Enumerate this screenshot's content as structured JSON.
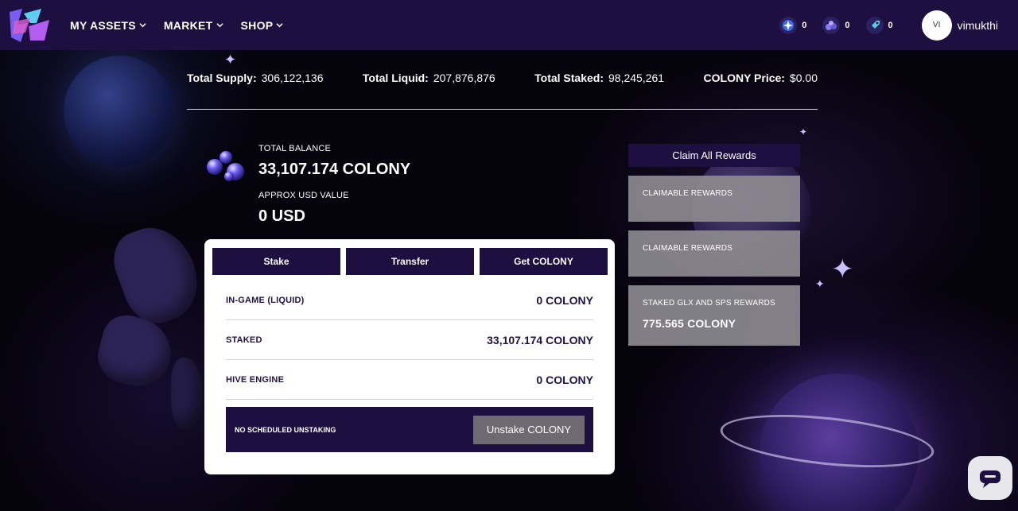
{
  "nav": {
    "items": [
      {
        "label": "MY ASSETS"
      },
      {
        "label": "MARKET"
      },
      {
        "label": "SHOP"
      }
    ]
  },
  "currencies": [
    {
      "icon": "star-orb-icon",
      "value": "0"
    },
    {
      "icon": "gem-cluster-icon",
      "value": "0"
    },
    {
      "icon": "rocket-icon",
      "value": "0"
    }
  ],
  "user": {
    "initials": "VI",
    "name": "vimukthi"
  },
  "stats": {
    "supply_label": "Total Supply:",
    "supply_value": "306,122,136",
    "liquid_label": "Total Liquid:",
    "liquid_value": "207,876,876",
    "staked_label": "Total Staked:",
    "staked_value": "98,245,261",
    "price_label": "COLONY Price:",
    "price_value": "$0.00"
  },
  "balance": {
    "total_label": "TOTAL BALANCE",
    "total_value": "33,107.174 COLONY",
    "usd_label": "APPROX USD VALUE",
    "usd_value": "0 USD"
  },
  "tabs": [
    "Stake",
    "Transfer",
    "Get COLONY"
  ],
  "rows": [
    {
      "label": "IN-GAME (LIQUID)",
      "value": "0 COLONY"
    },
    {
      "label": "STAKED",
      "value": "33,107.174 COLONY"
    },
    {
      "label": "HIVE ENGINE",
      "value": "0 COLONY"
    }
  ],
  "unstake": {
    "status": "NO SCHEDULED UNSTAKING",
    "button": "Unstake COLONY"
  },
  "rewards": {
    "claim_all": "Claim All Rewards",
    "cards": [
      {
        "title": "CLAIMABLE REWARDS",
        "value": ""
      },
      {
        "title": "CLAIMABLE REWARDS",
        "value": ""
      },
      {
        "title": "STAKED GLX AND SPS REWARDS",
        "value": "775.565 COLONY"
      }
    ]
  },
  "colors": {
    "header_bg": "#1d0f3f",
    "accent": "#1d0f3f",
    "card_bg": "#ffffff"
  }
}
